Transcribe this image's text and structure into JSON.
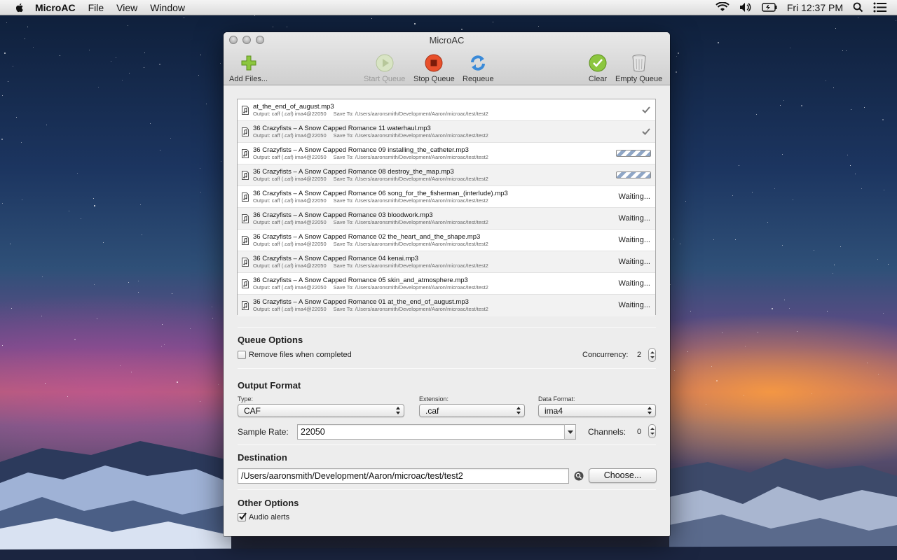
{
  "menubar": {
    "app_name": "MicroAC",
    "items": [
      "File",
      "View",
      "Window"
    ],
    "clock": "Fri 12:37 PM"
  },
  "window": {
    "title": "MicroAC",
    "toolbar": {
      "add_files": "Add Files...",
      "start_queue": "Start Queue",
      "stop_queue": "Stop Queue",
      "requeue": "Requeue",
      "clear": "Clear",
      "empty_queue": "Empty Queue"
    }
  },
  "queue": {
    "rows": [
      {
        "name": "at_the_end_of_august.mp3",
        "output": "Output: caff (.caf) ima4@22050",
        "save_to": "Save To: /Users/aaronsmith/Development/Aaron/microac/test/test2",
        "status": "done",
        "status_text": ""
      },
      {
        "name": "36 Crazyfists – A Snow Capped Romance 11 waterhaul.mp3",
        "output": "Output: caff (.caf) ima4@22050",
        "save_to": "Save To: /Users/aaronsmith/Development/Aaron/microac/test/test2",
        "status": "done",
        "status_text": ""
      },
      {
        "name": "36 Crazyfists – A Snow Capped Romance 09 installing_the_catheter.mp3",
        "output": "Output: caff (.caf) ima4@22050",
        "save_to": "Save To: /Users/aaronsmith/Development/Aaron/microac/test/test2",
        "status": "progress",
        "status_text": ""
      },
      {
        "name": "36 Crazyfists – A Snow Capped Romance 08 destroy_the_map.mp3",
        "output": "Output: caff (.caf) ima4@22050",
        "save_to": "Save To: /Users/aaronsmith/Development/Aaron/microac/test/test2",
        "status": "progress",
        "status_text": ""
      },
      {
        "name": "36 Crazyfists – A Snow Capped Romance 06 song_for_the_fisherman_(interlude).mp3",
        "output": "Output: caff (.caf) ima4@22050",
        "save_to": "Save To: /Users/aaronsmith/Development/Aaron/microac/test/test2",
        "status": "waiting",
        "status_text": "Waiting..."
      },
      {
        "name": "36 Crazyfists – A Snow Capped Romance 03 bloodwork.mp3",
        "output": "Output: caff (.caf) ima4@22050",
        "save_to": "Save To: /Users/aaronsmith/Development/Aaron/microac/test/test2",
        "status": "waiting",
        "status_text": "Waiting..."
      },
      {
        "name": "36 Crazyfists – A Snow Capped Romance 02 the_heart_and_the_shape.mp3",
        "output": "Output: caff (.caf) ima4@22050",
        "save_to": "Save To: /Users/aaronsmith/Development/Aaron/microac/test/test2",
        "status": "waiting",
        "status_text": "Waiting..."
      },
      {
        "name": "36 Crazyfists – A Snow Capped Romance 04 kenai.mp3",
        "output": "Output: caff (.caf) ima4@22050",
        "save_to": "Save To: /Users/aaronsmith/Development/Aaron/microac/test/test2",
        "status": "waiting",
        "status_text": "Waiting..."
      },
      {
        "name": "36 Crazyfists – A Snow Capped Romance 05 skin_and_atmosphere.mp3",
        "output": "Output: caff (.caf) ima4@22050",
        "save_to": "Save To: /Users/aaronsmith/Development/Aaron/microac/test/test2",
        "status": "waiting",
        "status_text": "Waiting..."
      },
      {
        "name": "36 Crazyfists – A Snow Capped Romance 01 at_the_end_of_august.mp3",
        "output": "Output: caff (.caf) ima4@22050",
        "save_to": "Save To: /Users/aaronsmith/Development/Aaron/microac/test/test2",
        "status": "waiting",
        "status_text": "Waiting..."
      }
    ]
  },
  "queue_options": {
    "title": "Queue Options",
    "remove_files_label": "Remove files when completed",
    "remove_files_checked": false,
    "concurrency_label": "Concurrency:",
    "concurrency_value": "2"
  },
  "output_format": {
    "title": "Output Format",
    "type_label": "Type:",
    "type_value": "CAF",
    "extension_label": "Extension:",
    "extension_value": ".caf",
    "data_format_label": "Data Format:",
    "data_format_value": "ima4",
    "sample_rate_label": "Sample Rate:",
    "sample_rate_value": "22050",
    "channels_label": "Channels:",
    "channels_value": "0"
  },
  "destination": {
    "title": "Destination",
    "path": "/Users/aaronsmith/Development/Aaron/microac/test/test2",
    "choose_label": "Choose..."
  },
  "other_options": {
    "title": "Other Options",
    "audio_alerts_label": "Audio alerts",
    "audio_alerts_checked": true
  }
}
